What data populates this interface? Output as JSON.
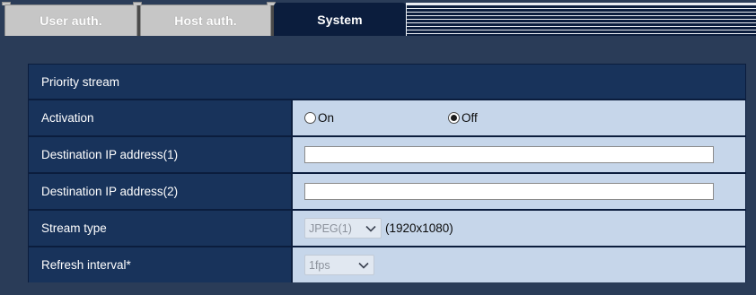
{
  "tabs": [
    {
      "label": "User auth.",
      "active": false
    },
    {
      "label": "Host auth.",
      "active": false
    },
    {
      "label": "System",
      "active": true
    }
  ],
  "panel": {
    "title": "Priority stream",
    "activation": {
      "label": "Activation",
      "options": [
        "On",
        "Off"
      ],
      "selected": "Off"
    },
    "dest_ip_1": {
      "label": "Destination IP address(1)",
      "value": ""
    },
    "dest_ip_2": {
      "label": "Destination IP address(2)",
      "value": ""
    },
    "stream_type": {
      "label": "Stream type",
      "selected": "JPEG(1)",
      "resolution": "(1920x1080)",
      "disabled": true
    },
    "refresh_interval": {
      "label": "Refresh interval*",
      "selected": "1fps",
      "disabled": true
    }
  },
  "colors": {
    "background": "#2a3c58",
    "tab_active": "#0b1d3d",
    "tab_inactive": "#c6c6c6",
    "label_cell": "#18335b",
    "value_cell": "#c6d6ea"
  },
  "icons": {
    "select_arrow": "chevron-down-icon"
  }
}
